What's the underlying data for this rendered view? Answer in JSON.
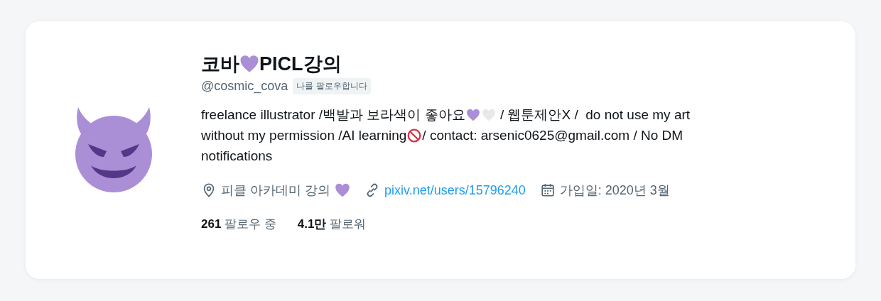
{
  "profile": {
    "name": [
      {
        "kind": "text",
        "text": "코바"
      },
      {
        "kind": "purple-heart"
      },
      {
        "kind": "text",
        "text": "PICL강의"
      }
    ],
    "handle": "@cosmic_cova",
    "follows_you_badge": "나를 팔로우합니다",
    "bio_lines": [
      [
        {
          "kind": "text",
          "text": "freelance illustrator /백발과 보라색이 좋아요"
        },
        {
          "kind": "purple-heart"
        },
        {
          "kind": "white-heart"
        },
        {
          "kind": "text",
          "text": " / 웹툰제안X /  do not use my art"
        }
      ],
      [
        {
          "kind": "text",
          "text": "without my permission /AI learning"
        },
        {
          "kind": "prohibited"
        },
        {
          "kind": "text",
          "text": "/ contact: arsenic0625@gmail.com / No DM"
        }
      ],
      [
        {
          "kind": "text",
          "text": "notifications"
        }
      ]
    ],
    "location": [
      {
        "kind": "text",
        "text": "피클 아카데미 강의"
      },
      {
        "kind": "purple-heart"
      }
    ],
    "website": "pixiv.net/users/15796240",
    "joined": "가입일: 2020년 3월",
    "stats": [
      {
        "count": "261",
        "label": "팔로우 중"
      },
      {
        "count": "4.1만",
        "label": "팔로워"
      }
    ]
  }
}
